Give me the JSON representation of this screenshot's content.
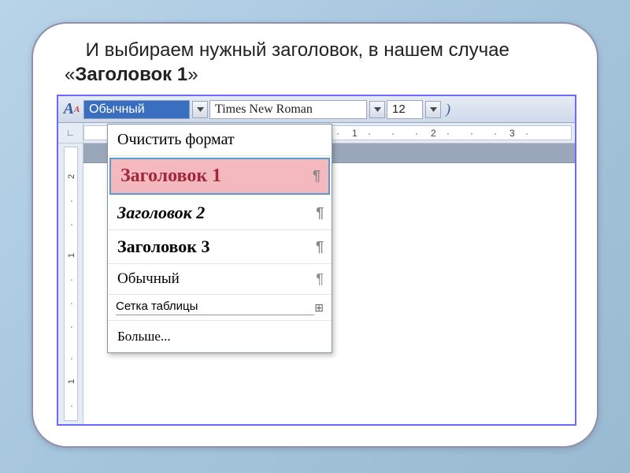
{
  "caption": {
    "prefix": "И выбираем нужный заголовок, в нашем случае «",
    "bold": "Заголовок 1",
    "suffix": "»"
  },
  "toolbar": {
    "style_value": "Обычный",
    "font_value": "Times New Roman",
    "size_value": "12"
  },
  "ruler": {
    "h_ticks": [
      "1",
      "2",
      "3"
    ],
    "v_ticks": [
      "2",
      "1",
      "1"
    ]
  },
  "dropdown": {
    "clear": "Очистить формат",
    "h1": "Заголовок 1",
    "h2": "Заголовок 2",
    "h3": "Заголовок 3",
    "normal": "Обычный",
    "tablegrid": "Сетка таблицы",
    "more": "Больше...",
    "pilcrow": "¶",
    "table_glyph": "⊞"
  }
}
